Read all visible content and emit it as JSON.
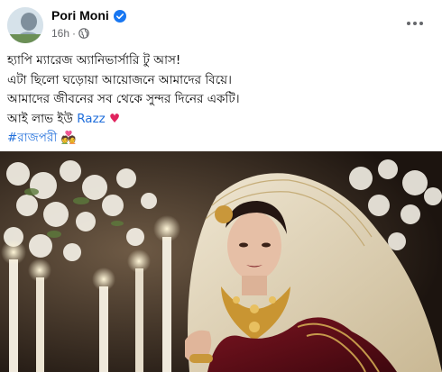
{
  "post": {
    "author": "Pori Moni",
    "time": "16h",
    "separator": "·",
    "lines": [
      "হ্যাপি ম্যারেজ অ্যানিভার্সারি টু আস!",
      "এটা ছিলো ঘড়োয়া আয়োজনে আমাদের বিয়ে।",
      "আমাদের জীবনের সব থেকে সুন্দর দিনের একটি।"
    ],
    "love_prefix": "আই লাভ ইউ ",
    "mention": "Razz",
    "heart_emoji": "♥",
    "hashtag": "#রাজপরী",
    "couple_emoji": "💑"
  },
  "icons": {
    "verified": "verified-badge-icon",
    "privacy": "globe-icon",
    "more": "more-options-icon"
  },
  "colors": {
    "link": "#216fdb",
    "verified": "#1877f2",
    "secondary_text": "#65676b",
    "heart": "#e0245e"
  }
}
